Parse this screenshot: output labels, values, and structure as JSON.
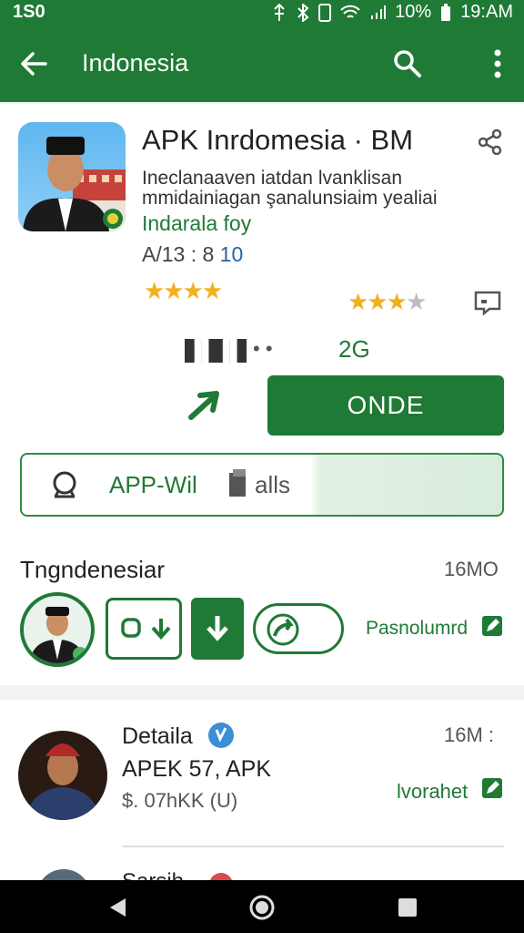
{
  "status_bar": {
    "time_left": "1S0",
    "time_right": "19:AM",
    "battery": "10%"
  },
  "app_bar": {
    "title": "Indonesia"
  },
  "app": {
    "title": "APK Inrdomesia · BM",
    "description_line1": "Ineclanaaven iatdan lvanklisan",
    "description_line2": "mmidainiagan şanalunsiaim yealiai",
    "developer": "Indarala foy",
    "version_label": "A/13 : 8",
    "version_number": "10",
    "stats_left": "▐▌▐▌",
    "stats_dots": "• •",
    "stats_size": "2G",
    "install_label": "ONDE"
  },
  "feature_bar": {
    "label_a": "APP-Wil",
    "label_b": "alls"
  },
  "section": {
    "title": "Tngndenesiar",
    "count": "16MO",
    "action_label": "Pasnolumrd"
  },
  "detail_item": {
    "title": "Detaila",
    "line1": "APEK 57, APK",
    "line2": "$. 07hKK (U)",
    "count": "16M :",
    "action_label": "lvorahet"
  },
  "partial_item": {
    "title": "Sarsih"
  },
  "colors": {
    "brand_green": "#1f7a36",
    "star": "#f2b01e"
  }
}
